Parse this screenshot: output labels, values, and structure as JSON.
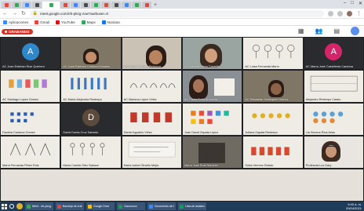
{
  "browser": {
    "url": "meet.google.com/rrb-pkzg-zow?authuser=0",
    "bookmarks": [
      "Aplicaciones",
      "Gmail",
      "YouTube",
      "Maps",
      "Noticias"
    ]
  },
  "meet": {
    "recording_label": "GRABANDO",
    "tools": [
      "",
      "",
      ""
    ],
    "participants": [
      {
        "name": "AC Juan Esteban Ruiz Quintero",
        "avatar": "A",
        "avatar_color": "#2f88c9"
      },
      {
        "name": "AC Juan Esteban Cardona Morales"
      },
      {
        "name": "AC Fernanda Ruiz Betancur"
      },
      {
        "name": "AC Isabella Mesa Castaño"
      },
      {
        "name": "AC Luisa Fernanda Marín"
      },
      {
        "name": "AC María José Castañeda Cardona",
        "avatar": "A",
        "avatar_color": "#d6246b"
      },
      {
        "name": "AC Santiago López Gómez"
      },
      {
        "name": "AC María Alejandra Restrepo"
      },
      {
        "name": "AC Mariana López Vélez"
      },
      {
        "name": "AC Paula Sofía Arboleda"
      },
      {
        "name": "AC Sebastián Velásquez Gómez"
      },
      {
        "name": "Alejandro Restrepo Castro"
      },
      {
        "name": "Daniela Cardona Gómez"
      },
      {
        "name": "David Dorda Cruz Salcedo",
        "avatar": "D",
        "avatar_color": "#5c4a3d"
      },
      {
        "name": "Daniel Agudelo Vélez"
      },
      {
        "name": "Juan David Zapata López"
      },
      {
        "name": "Juliana Zapata Restrepo"
      },
      {
        "name": "Lia Ximena Ríos Arias"
      },
      {
        "name": "María Fernanda Pérez Ruiz"
      },
      {
        "name": "María Camila Ortiz Salazar"
      },
      {
        "name": "María Isabel Giraldo Mejía"
      },
      {
        "name": "María José Ruiz Ramírez"
      },
      {
        "name": "Sofía Herrera Giraldo"
      },
      {
        "name": "Profesora Luz Dary"
      }
    ]
  },
  "taskbar": {
    "items": [
      "Meet - rrb-pkzg-zow",
      "Bandeja de entrada",
      "Google Drive",
      "Classroom",
      "Documento sin título",
      "Lista de asistencia"
    ],
    "time": "9:40 a. m.",
    "date": "20/04/2021"
  }
}
